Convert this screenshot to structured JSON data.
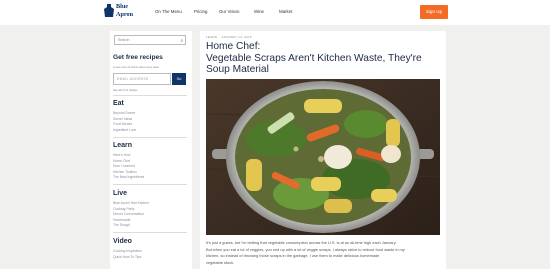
{
  "header": {
    "logo_line1": "Blue",
    "logo_line2": "Apron",
    "nav": [
      "On The Menu",
      "Pricing",
      "Our Vision",
      "Wine",
      "Market"
    ],
    "signup_label": "Sign Up"
  },
  "sidebar": {
    "search_placeholder": "Search",
    "recipes_title": "Get free recipes",
    "recipes_caption": "A new menu of dinner ideas every week",
    "email_placeholder": "EMAIL ADDRESS",
    "go_label": "Go",
    "recipes_link": "See all of our recipes",
    "sections": [
      {
        "title": "Eat",
        "items": [
          "Beyond Dinner",
          "Dinner Ideas",
          "Food Stories",
          "Ingredient Love"
        ]
      },
      {
        "title": "Learn",
        "items": [
          "Here's How",
          "Home Chef",
          "How I Learned",
          "Kitchen Toolbox",
          "The Best Ingredients"
        ]
      },
      {
        "title": "Live",
        "items": [
          "Blue Apron Test Kitchen",
          "Cooking Party",
          "Dinner Conversation",
          "Homemade",
          "The Dough"
        ]
      },
      {
        "title": "Video",
        "items": [
          "Cooking Inspiration",
          "Quick How-To Tips"
        ]
      }
    ]
  },
  "article": {
    "category": "LEARN",
    "date": "JANUARY 14, 2016",
    "title_line1": "Home Chef:",
    "title_line2": "Vegetable Scraps Aren't Kitchen Waste, They're",
    "title_line3": "Soup Material",
    "image_alt": "Stock pot with corn, carrots, leeks and vegetable scraps",
    "body_line1": "It's just a guess, but I'm betting that vegetable consumption across the U.S. is at an all-time high each January.",
    "body_line2": "But when you eat a lot of veggies, you end up with a lot of veggie scraps. I always strive to reduce food waste in my",
    "body_line3": "kitchen, so instead of throwing those scraps in the garbage, I use them to make delicious homemade",
    "body_line4": "vegetable stock."
  }
}
